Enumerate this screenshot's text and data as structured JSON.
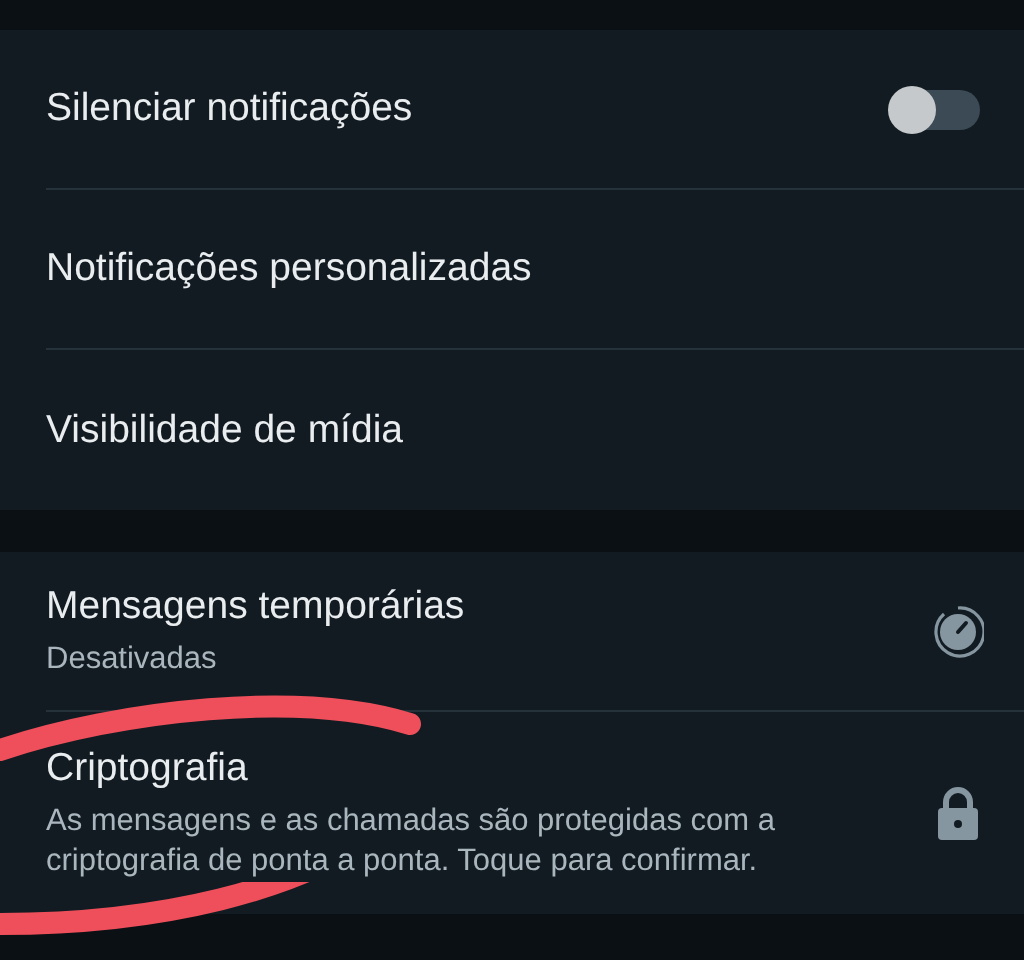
{
  "sections": [
    {
      "rows": [
        {
          "kind": "toggle",
          "title": "Silenciar notificações",
          "on": false
        },
        {
          "kind": "plain",
          "title": "Notificações personalizadas"
        },
        {
          "kind": "plain",
          "title": "Visibilidade de mídia"
        }
      ]
    },
    {
      "rows": [
        {
          "kind": "timer",
          "title": "Mensagens temporárias",
          "subtitle": "Desativadas"
        },
        {
          "kind": "lock",
          "title": "Criptografia",
          "subtitle": "As mensagens e as chamadas são protegidas com a criptografia de ponta a ponta. Toque para confirmar."
        }
      ]
    }
  ],
  "annotation": {
    "kind": "stroke"
  }
}
